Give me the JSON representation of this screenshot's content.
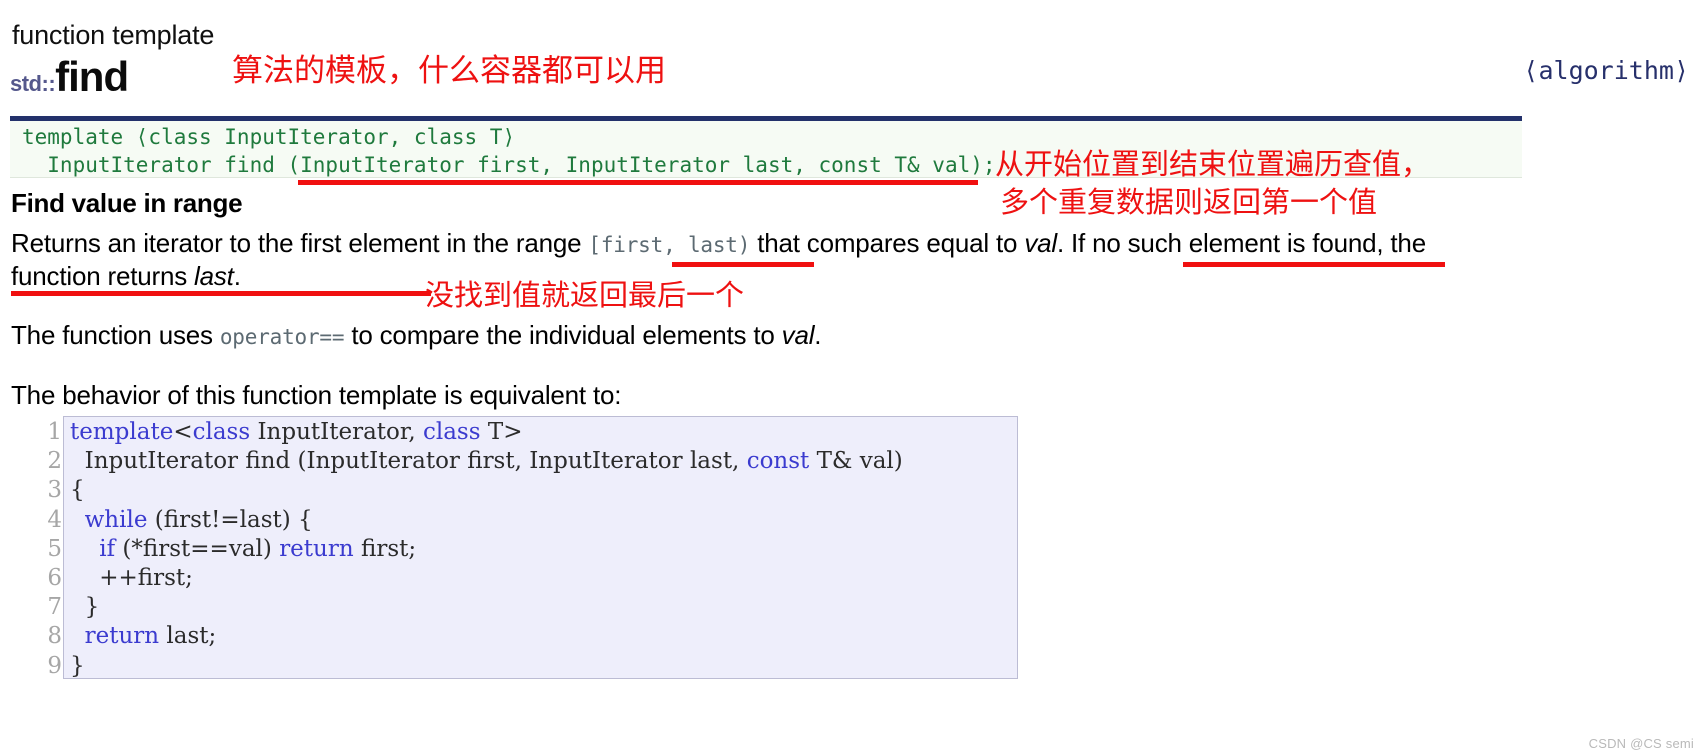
{
  "header": {
    "kind": "function template",
    "namespace": "std::",
    "name": "find",
    "annotation": "算法的模板，什么容器都可以用",
    "include": "⟨algorithm⟩"
  },
  "prototype": {
    "line1": "template ⟨class InputIterator, class T⟩",
    "line2": "  InputIterator find (InputIterator first, InputIterator last, const T& val);",
    "annotation_line1": "从开始位置到结束位置遍历查值，",
    "annotation_line2": "多个重复数据则返回第一个值"
  },
  "section": {
    "heading": "Find value in range",
    "paragraph1": {
      "part1": "Returns an iterator to the first element in the range ",
      "range": "[first, last)",
      "part2": " that compares equal to ",
      "val1": "val",
      "part3": ". If no such element is found, the function returns ",
      "last": "last",
      "part4": "."
    },
    "paragraph1_annotation": "没找到值就返回最后一个",
    "paragraph2": {
      "part1": "The function uses ",
      "op": "operator==",
      "part2": " to compare the individual elements to ",
      "val": "val",
      "part3": "."
    },
    "paragraph3": "The behavior of this function template is equivalent to:"
  },
  "code": {
    "line_numbers": [
      "1",
      "2",
      "3",
      "4",
      "5",
      "6",
      "7",
      "8",
      "9"
    ],
    "lines": [
      "template<class InputIterator, class T>",
      "  InputIterator find (InputIterator first, InputIterator last, const T& val)",
      "{",
      "  while (first!=last) {",
      "    if (*first==val) return first;",
      "    ++first;",
      "  }",
      "  return last;",
      "}"
    ],
    "keywords": [
      "template",
      "class",
      "while",
      "if",
      "return",
      "const"
    ]
  },
  "watermark": "CSDN @CS semi",
  "colors": {
    "accent_rule": "#23316b",
    "annotation_red": "#ee1111",
    "prototype_green": "#1f7a3d",
    "code_keyword": "#3b3bcf",
    "code_background": "#eeeefb",
    "namespace": "#55588c"
  }
}
